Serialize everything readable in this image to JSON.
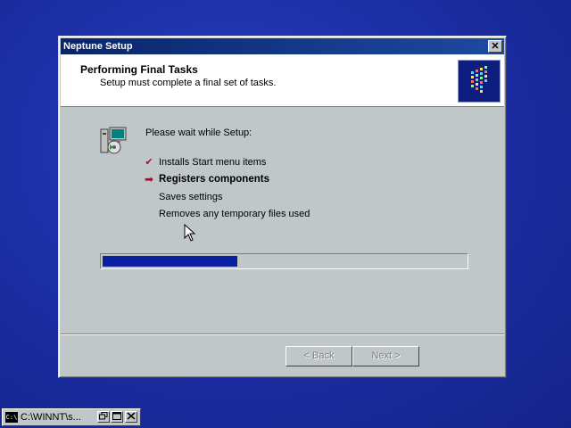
{
  "window": {
    "title": "Neptune Setup",
    "close_glyph": "✕"
  },
  "header": {
    "title": "Performing Final Tasks",
    "subtitle": "Setup must complete a final set of tasks."
  },
  "content": {
    "wait_text": "Please wait while Setup:",
    "tasks": [
      {
        "label": "Installs Start menu items",
        "status": "done",
        "mark": "✔"
      },
      {
        "label": "Registers components",
        "status": "current",
        "mark": "➡"
      },
      {
        "label": "Saves settings",
        "status": "pending",
        "mark": ""
      },
      {
        "label": "Removes any temporary files used",
        "status": "pending",
        "mark": ""
      }
    ],
    "progress": 0.37
  },
  "buttons": {
    "back": "< Back",
    "next": "Next >"
  },
  "taskbar": {
    "label": "C:\\WINNT\\s...",
    "icon_text": "C:\\"
  },
  "colors": {
    "desktop": "#1b2fa8",
    "title_bar": "#0a246a",
    "progress_fill": "#0a1fa0",
    "done_mark": "#a01030",
    "current_mark": "#a01030"
  }
}
